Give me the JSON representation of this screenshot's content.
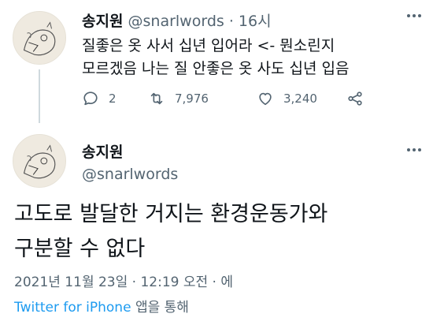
{
  "reply_tweet": {
    "display_name": "송지원",
    "handle": "@snarlwords",
    "separator": "·",
    "time_ago": "16시",
    "text": "질좋은 옷 사서 십년 입어라 <- 뭔소린지\n모르겠음 나는 질 안좋은 옷 사도 십년 입음",
    "replies": "2",
    "retweets": "7,976",
    "likes": "3,240",
    "more_icon": "more-dots-icon"
  },
  "main_tweet": {
    "display_name": "송지원",
    "handle": "@snarlwords",
    "text": "고도로 발달한 거지는 환경운동가와\n구분할 수 없다",
    "date": "2021년 11월 23일 · 12:19 오전 · 에",
    "source_link": "Twitter for iPhone",
    "source_suffix": " 앱을 통해",
    "more_icon": "more-dots-icon"
  },
  "colors": {
    "accent": "#1d9bf0",
    "muted": "#536471",
    "text": "#0f1419"
  }
}
